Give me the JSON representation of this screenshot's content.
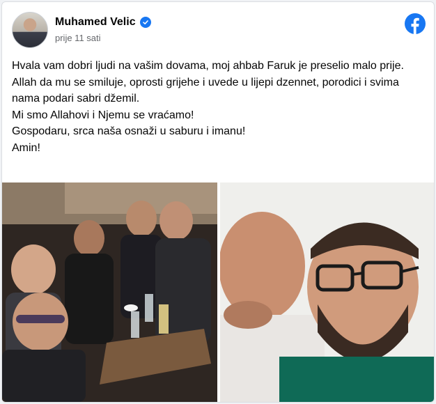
{
  "post": {
    "author": "Muhamed Velic",
    "time": "prije 11 sati",
    "lines": [
      "Hvala vam dobri ljudi na vašim dovama, moj ahbab Faruk je preselio malo prije.",
      "Allah da mu se smiluje, oprosti grijehe i uvede u lijepi dzennet, porodici i svima nama podari sabri džemil.",
      "Mi smo Allahovi i Njemu se vraćamo!",
      "Gospodaru, srca naša osnaži u saburu i imanu!",
      "Amin!"
    ]
  },
  "icons": {
    "verified": "verified-badge-icon",
    "brand": "facebook-logo-icon"
  },
  "colors": {
    "brand": "#1877f2",
    "text": "#050505",
    "muted": "#65676b"
  }
}
